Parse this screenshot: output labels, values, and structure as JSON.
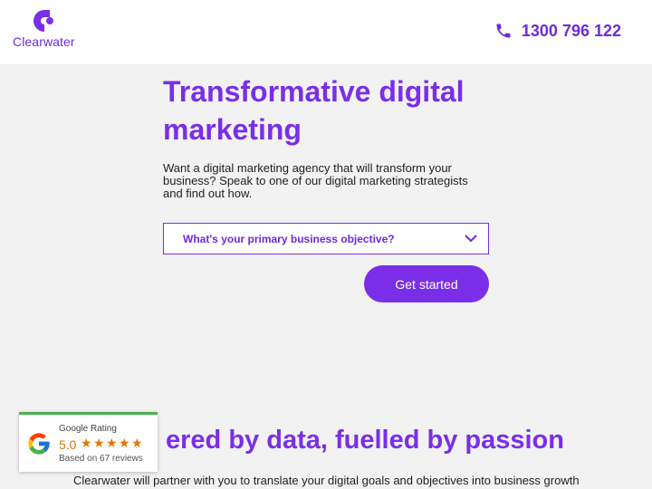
{
  "header": {
    "brand_name": "Clearwater",
    "phone_number": "1300 796 122",
    "brand_color": "#6b2be0"
  },
  "hero": {
    "title": "Transformative digital marketing",
    "description": "Want a digital marketing agency that will transform your business? Speak to one of our digital marketing strategists and find out how.",
    "select_value": "What's your primary business objective?",
    "cta_label": "Get started"
  },
  "section": {
    "title": "ered by data, fuelled by passion",
    "text": "Clearwater will partner with you to translate your digital goals and objectives into business growth"
  },
  "rating_widget": {
    "label": "Google Rating",
    "score": "5.0",
    "stars": 5,
    "reviews": "Based on 67 reviews",
    "accent_color": "#4caf50",
    "star_color": "#e37400"
  },
  "icons": [
    "clearwater-logo-icon",
    "phone-icon",
    "chevron-down-icon",
    "google-g-icon",
    "star-icon"
  ]
}
